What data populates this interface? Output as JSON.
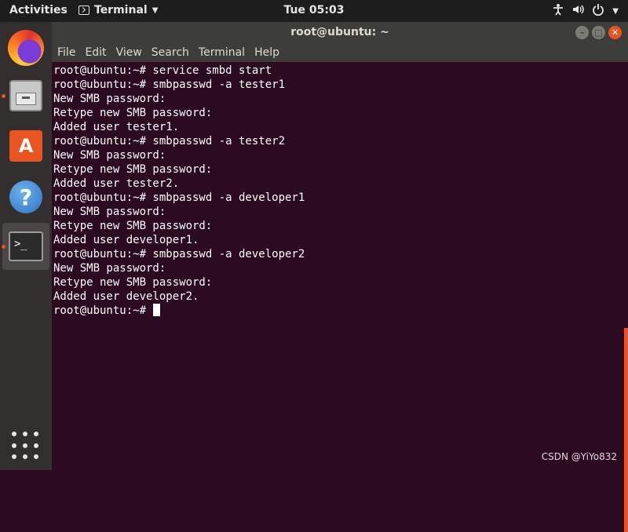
{
  "topbar": {
    "activities": "Activities",
    "app_name": "Terminal",
    "clock": "Tue 05:03",
    "tray_icons": [
      "accessibility-icon",
      "volume-icon",
      "power-icon",
      "chevron-down-icon"
    ]
  },
  "dock": {
    "items": [
      {
        "name": "firefox"
      },
      {
        "name": "files"
      },
      {
        "name": "software-store"
      },
      {
        "name": "help"
      },
      {
        "name": "terminal"
      }
    ],
    "store_glyph": "A",
    "help_glyph": "?",
    "terminal_glyph": ">_"
  },
  "window": {
    "title": "root@ubuntu: ~",
    "menu": [
      "File",
      "Edit",
      "View",
      "Search",
      "Terminal",
      "Help"
    ]
  },
  "terminal": {
    "lines": [
      "root@ubuntu:~# service smbd start",
      "root@ubuntu:~# smbpasswd -a tester1",
      "New SMB password:",
      "Retype new SMB password:",
      "Added user tester1.",
      "root@ubuntu:~# smbpasswd -a tester2",
      "New SMB password:",
      "Retype new SMB password:",
      "Added user tester2.",
      "root@ubuntu:~# smbpasswd -a developer1",
      "New SMB password:",
      "Retype new SMB password:",
      "Added user developer1.",
      "root@ubuntu:~# smbpasswd -a developer2",
      "New SMB password:",
      "Retype new SMB password:",
      "Added user developer2."
    ],
    "prompt": "root@ubuntu:~# "
  },
  "watermark": "CSDN @YiYo832",
  "colors": {
    "accent": "#e95420",
    "terminal_bg": "#2c0a22",
    "topbar_bg": "#1d1d1d",
    "dock_bg": "#322f2e"
  }
}
